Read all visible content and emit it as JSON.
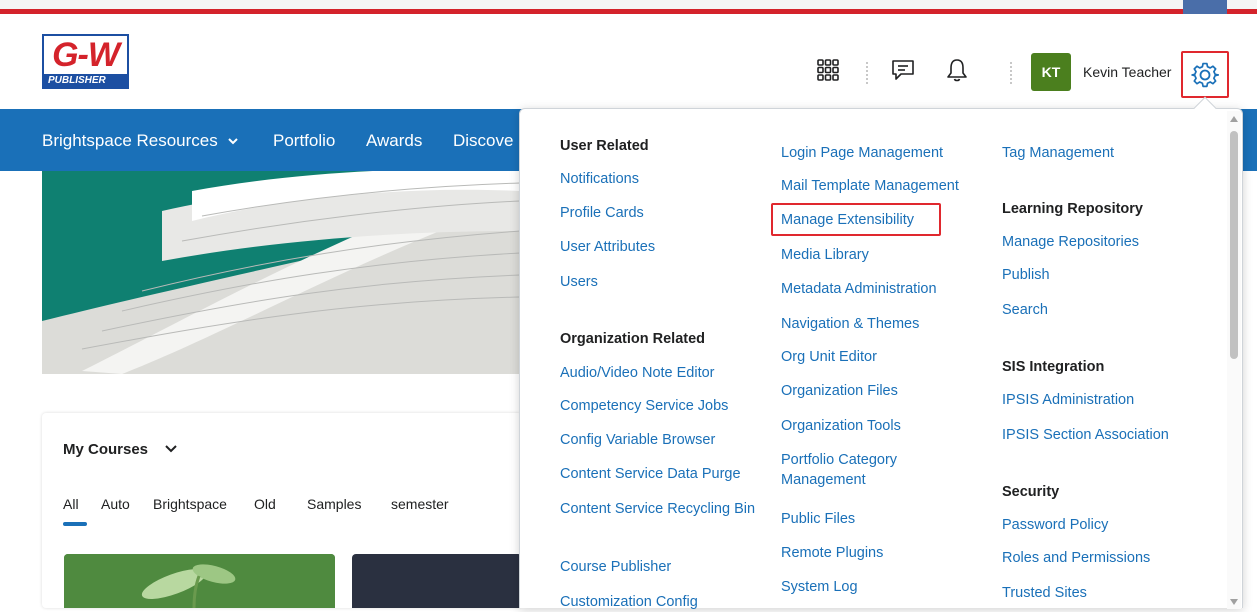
{
  "brand": {
    "logo_text": "G-W",
    "logo_subtext": "PUBLISHER",
    "accent_color": "#1a70b8",
    "brand_red": "#d4232b"
  },
  "header": {
    "icons": [
      "waffle-icon",
      "chat-icon",
      "bell-icon",
      "gear-icon"
    ],
    "user_initials": "KT",
    "user_name": "Kevin Teacher"
  },
  "navbar": {
    "items": [
      {
        "label": "Brightspace Resources",
        "has_dropdown": true
      },
      {
        "label": "Portfolio"
      },
      {
        "label": "Awards"
      },
      {
        "label": "Discove"
      }
    ]
  },
  "my_courses": {
    "title": "My Courses",
    "tabs": [
      "All",
      "Auto",
      "Brightspace",
      "Old",
      "Samples",
      "semester"
    ],
    "selected_tab": "All"
  },
  "admin_menu": {
    "col1": {
      "sections": [
        {
          "heading": "User Related",
          "links": [
            "Notifications",
            "Profile Cards",
            "User Attributes",
            "Users"
          ]
        },
        {
          "heading": "Organization Related",
          "links": [
            "Audio/Video Note Editor",
            "Competency Service Jobs",
            "Config Variable Browser",
            "Content Service Data Purge",
            "Content Service Recycling Bin",
            "Course Publisher",
            "Customization Config"
          ]
        }
      ]
    },
    "col2": {
      "links": [
        "Login Page Management",
        "Mail Template Management",
        "Manage Extensibility",
        "Media Library",
        "Metadata Administration",
        "Navigation & Themes",
        "Org Unit Editor",
        "Organization Files",
        "Organization Tools",
        "Portfolio Category Management",
        "Public Files",
        "Remote Plugins",
        "System Log"
      ],
      "highlighted": "Manage Extensibility"
    },
    "col3": {
      "top_link": "Tag Management",
      "sections": [
        {
          "heading": "Learning Repository",
          "links": [
            "Manage Repositories",
            "Publish",
            "Search"
          ]
        },
        {
          "heading": "SIS Integration",
          "links": [
            "IPSIS Administration",
            "IPSIS Section Association"
          ]
        },
        {
          "heading": "Security",
          "links": [
            "Password Policy",
            "Roles and Permissions",
            "Trusted Sites"
          ]
        }
      ]
    }
  }
}
